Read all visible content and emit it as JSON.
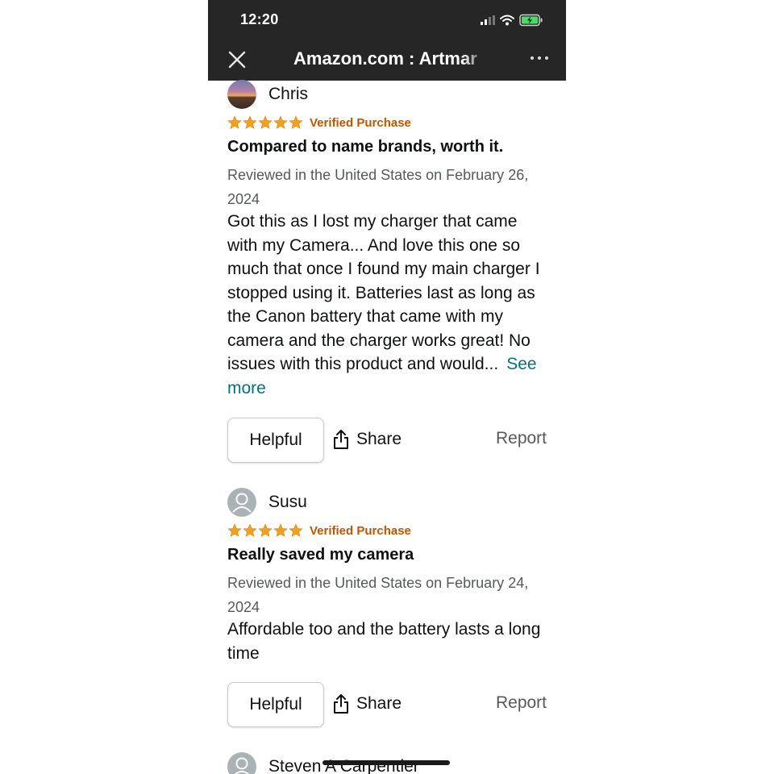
{
  "status_bar": {
    "time": "12:20"
  },
  "browser": {
    "title": "Amazon.com : Artmar"
  },
  "reviews": [
    {
      "name": "Chris",
      "rating": 5,
      "verified": "Verified Purchase",
      "title": "Compared to name brands, worth it.",
      "date": "Reviewed in the United States on February 26, 2024",
      "body": "Got this as I lost my charger that came with my Camera... And love this one so much that once I found my main charger I stopped using it. Batteries last as long as the Canon battery that came with my camera and the charger works great! No issues with this product and would...",
      "see_more": "See more",
      "helpful": "Helpful",
      "share": "Share",
      "report": "Report"
    },
    {
      "name": "Susu",
      "rating": 5,
      "verified": "Verified Purchase",
      "title": "Really saved my camera",
      "date": "Reviewed in the United States on February 24, 2024",
      "body": "Affordable too and the battery lasts a long time",
      "helpful": "Helpful",
      "share": "Share",
      "report": "Report"
    },
    {
      "name": "Steven A Carpentier"
    }
  ],
  "colors": {
    "header_bg": "#262626",
    "star": "#f59f1b",
    "verified": "#c45500",
    "link": "#007185",
    "secondary_text": "#565959",
    "battery": "#4cd964"
  },
  "icons": [
    "close-icon",
    "more-icon",
    "signal-icon",
    "wifi-icon",
    "battery-icon",
    "star-icon",
    "share-icon",
    "user-icon"
  ]
}
